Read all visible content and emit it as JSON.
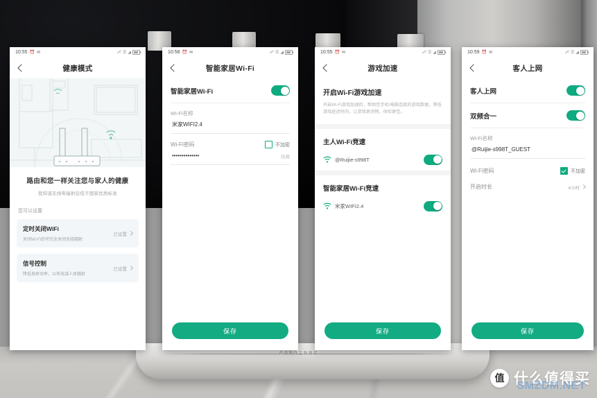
{
  "background": {
    "description": "router-photo-background",
    "footer_engraving": "产品制作互联网可"
  },
  "watermark": {
    "badge": "值",
    "text": "什么值得买",
    "net": "SMZDM.NET"
  },
  "phones": [
    {
      "id": "health-mode",
      "status": {
        "time": "10:55",
        "icons": "signal-wifi-battery"
      },
      "nav_title": "健康模式",
      "hero": {
        "title": "路由和您一样关注您与家人的健康",
        "subtitle": "我知道无线电辐射远低于国家优质标准"
      },
      "section_label": "您可以设置",
      "cards": [
        {
          "title": "定时关闭WiFi",
          "desc": "关闭Wi-Fi后可完全关闭无线辐射",
          "action": "已设置"
        },
        {
          "title": "信号控制",
          "desc": "降低发射功率，以有效减人体辐射",
          "action": "已设置"
        }
      ]
    },
    {
      "id": "smart-home-wifi",
      "status": {
        "time": "10:58"
      },
      "nav_title": "智能家居Wi-Fi",
      "toggle_label": "智能家居Wi-Fi",
      "toggle_on": true,
      "ssid_label": "Wi-Fi名称",
      "ssid_value": "米家WIFI2.4",
      "password_label": "Wi-Fi密码",
      "no_encrypt_label": "不加密",
      "no_encrypt_checked": false,
      "password_value": "••••••••••••••",
      "password_hint": "隐藏",
      "save_label": "保存"
    },
    {
      "id": "game-acceleration",
      "status": {
        "time": "10:55"
      },
      "nav_title": "游戏加速",
      "block_title": "开启Wi-Fi游戏加速",
      "block_desc": "开启Wi-Fi游戏加速后，帮助您手机/电脑连接的游戏数据，降低游戏延迟时间，让游戏更流畅，体验更佳。",
      "section1_title": "主人Wi-Fi竞速",
      "wifi1_name": "@Ruijie-s998T",
      "wifi1_on": true,
      "section2_title": "智能家居Wi-Fi竞速",
      "wifi2_name": "米家WIFI2.4",
      "wifi2_on": true,
      "save_label": "保存"
    },
    {
      "id": "guest-network",
      "status": {
        "time": "10:59"
      },
      "nav_title": "客人上网",
      "row1_label": "客人上网",
      "row1_on": true,
      "row2_label": "双频合一",
      "row2_on": true,
      "ssid_label": "Wi-Fi名称",
      "ssid_value": "@Ruijie-s998T_GUEST",
      "password_label": "Wi-Fi密码",
      "no_encrypt_label": "不加密",
      "no_encrypt_checked": true,
      "duration_label": "开启时长",
      "duration_value": "4小时",
      "save_label": "保存"
    }
  ]
}
